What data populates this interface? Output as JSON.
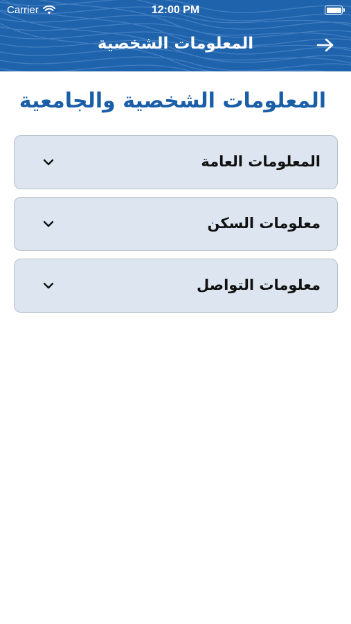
{
  "status_bar": {
    "carrier": "Carrier",
    "time": "12:00 PM"
  },
  "nav": {
    "title": "المعلومات الشخصية",
    "back_icon": "arrow-right-icon"
  },
  "page": {
    "title": "المعلومات الشخصية والجامعية"
  },
  "sections": [
    {
      "label": "المعلومات العامة",
      "icon": "chevron-down-icon"
    },
    {
      "label": "معلومات السكن",
      "icon": "chevron-down-icon"
    },
    {
      "label": "معلومات التواصل",
      "icon": "chevron-down-icon"
    }
  ],
  "colors": {
    "header_bg": "#1f63ad",
    "title_color": "#1a5ea8",
    "section_bg": "#dde6f0"
  }
}
